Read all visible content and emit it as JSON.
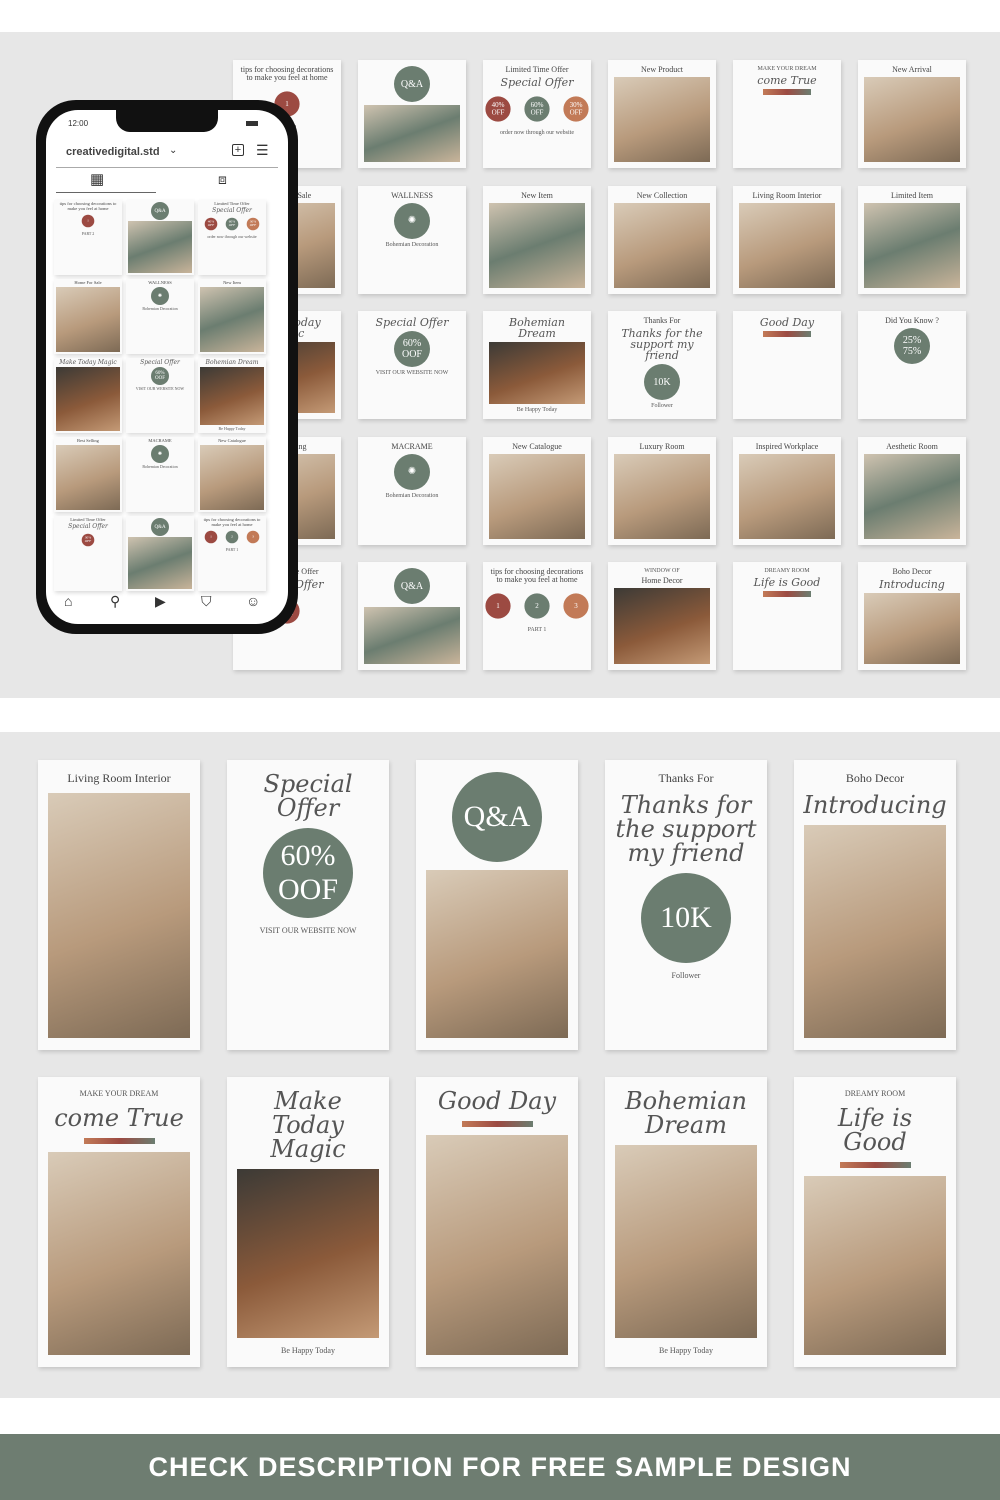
{
  "colors": {
    "sage": "#6b7d70",
    "terracotta": "#c27a57",
    "rust": "#9c4a42",
    "banner": "#6e7d71"
  },
  "posts": [
    {
      "title": "tips for choosing decorations to make you feel at home",
      "caption": "PART 2",
      "photo": "none",
      "labels": [
        "1"
      ]
    },
    {
      "badge": "Q&A",
      "photo": "green"
    },
    {
      "title": "Limited Time Offer",
      "script": "Special Offer",
      "labels": [
        "40% OFF",
        "60% OFF",
        "30% OFF"
      ],
      "caption": "order now through our website",
      "photo": "none"
    },
    {
      "title": "New Product",
      "photo": "warm"
    },
    {
      "script": "come True",
      "caption": "MAKE YOUR DREAM",
      "stripe": true,
      "photo": "none"
    },
    {
      "title": "New Arrival",
      "photo": "warm"
    },
    {
      "title": "Home For Sale",
      "photo": "warm"
    },
    {
      "title": "WALLNESS",
      "caption": "Bohemian Decoration",
      "badge": "✺",
      "photo": "none"
    },
    {
      "title": "New Item",
      "photo": "green"
    },
    {
      "title": "New Collection",
      "photo": "warm"
    },
    {
      "title": "Living Room Interior",
      "photo": "warm"
    },
    {
      "title": "Limited Item",
      "photo": "green"
    },
    {
      "script": "Make Today Magic",
      "photo": "dark"
    },
    {
      "script": "Special Offer",
      "badge": "60% OOF",
      "caption": "VISIT OUR WEBSITE NOW",
      "photo": "none"
    },
    {
      "script": "Bohemian Dream",
      "caption": "Be Happy Today",
      "photo": "dark"
    },
    {
      "title": "Thanks For",
      "badge": "10K",
      "caption": "Follower",
      "script": "Thanks for the support my friend",
      "photo": "none"
    },
    {
      "script": "Good Day",
      "stripe": true,
      "photo": "none"
    },
    {
      "title": "Did You Know ?",
      "badge": "25% 75%",
      "photo": "none"
    },
    {
      "title": "Best Selling",
      "photo": "warm"
    },
    {
      "title": "MACRAME",
      "caption": "Bohemian Decoration",
      "badge": "✺",
      "photo": "none"
    },
    {
      "title": "New Catalogue",
      "photo": "warm"
    },
    {
      "title": "Luxury Room",
      "photo": "warm"
    },
    {
      "title": "Inspired Workplace",
      "photo": "warm"
    },
    {
      "title": "Aesthetic Room",
      "photo": "green"
    },
    {
      "title": "Limited Time Offer",
      "script": "Special Offer",
      "labels": [
        "30% OFF"
      ],
      "photo": "none"
    },
    {
      "badge": "Q&A",
      "photo": "green"
    },
    {
      "title": "tips for choosing decorations to make you feel at home",
      "caption": "PART 1",
      "labels": [
        "1",
        "2",
        "3"
      ],
      "photo": "none"
    },
    {
      "title": "Home Decor",
      "caption": "WINDOW OF",
      "photo": "dark"
    },
    {
      "script": "Life is Good",
      "caption": "DREAMY ROOM",
      "stripe": true,
      "photo": "none"
    },
    {
      "title": "Boho Decor",
      "script": "Introducing",
      "photo": "warm"
    }
  ],
  "phone": {
    "time": "12:00",
    "username": "creativedigital.std",
    "chevron": "chevron-down-icon",
    "icons": [
      "plus-square-icon",
      "menu-icon",
      "grid-icon",
      "tagged-icon",
      "home-icon",
      "search-icon",
      "reels-icon",
      "shop-icon",
      "profile-icon"
    ]
  },
  "stories": [
    {
      "title": "Living Room Interior",
      "photo": "warm"
    },
    {
      "script": "Special Offer",
      "badge": "60% OOF",
      "caption": "VISIT OUR WEBSITE NOW",
      "photo": "none"
    },
    {
      "badge": "Q&A",
      "photo": "warm"
    },
    {
      "title": "Thanks For",
      "badge": "10K",
      "caption": "Follower",
      "script": "Thanks for the support my friend",
      "photo": "none"
    },
    {
      "title": "Boho Decor",
      "script": "Introducing",
      "photo": "warm"
    },
    {
      "script": "come True",
      "caption": "MAKE YOUR DREAM",
      "stripe": true,
      "photo": "warm"
    },
    {
      "script": "Make Today Magic",
      "caption": "Be Happy Today",
      "photo": "dark"
    },
    {
      "script": "Good Day",
      "stripe": true,
      "photo": "warm"
    },
    {
      "script": "Bohemian Dream",
      "caption": "Be Happy Today",
      "photo": "warm"
    },
    {
      "script": "Life is Good",
      "caption": "DREAMY ROOM",
      "stripe": true,
      "photo": "warm"
    }
  ],
  "banner": {
    "text": "CHECK DESCRIPTION FOR FREE SAMPLE DESIGN"
  }
}
